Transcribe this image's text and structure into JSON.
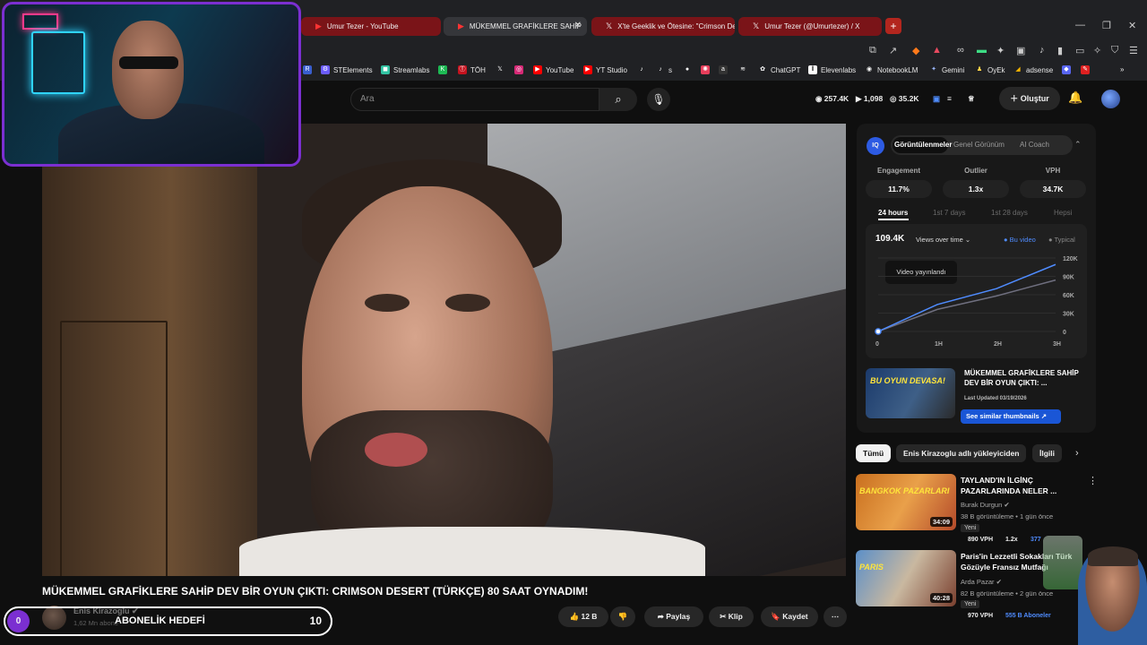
{
  "browser": {
    "tabs": [
      {
        "title": "Umur Tezer - YouTube",
        "icon": "youtube-icon"
      },
      {
        "title": "MÜKEMMEL GRAFİKLERE SAHİP",
        "icon": "youtube-icon"
      },
      {
        "title": "X'te Geeklik ve Ötesine: \"Crimson De",
        "icon": "x-icon"
      },
      {
        "title": "Umur Tezer (@Umurtezer) / X",
        "icon": "x-icon"
      }
    ],
    "new_tab": "+",
    "bookmarks": [
      "STElements",
      "Streamlabs",
      "TÖH",
      "YouTube",
      "YT Studio",
      "s",
      "ChatGPT",
      "Elevenlabs",
      "NotebookLM",
      "Gemini",
      "OyEk",
      "adsense"
    ]
  },
  "header": {
    "search_placeholder": "Ara",
    "stats": {
      "views": "257.4K",
      "videos": "1,098",
      "subs": "35.2K"
    },
    "create_label": "Oluştur"
  },
  "panel": {
    "logo": "IQ",
    "tabs": [
      "Görüntülenmeler",
      "Genel Görünüm",
      "AI Coach"
    ],
    "metrics": [
      {
        "label": "Engagement",
        "value": "11.7%"
      },
      {
        "label": "Outlier",
        "value": "1.3x"
      },
      {
        "label": "VPH",
        "value": "34.7K"
      }
    ],
    "ranges": [
      "24 hours",
      "1st 7 days",
      "1st 28 days",
      "Hepsi"
    ],
    "total": "109.4K",
    "dropdown": "Views over time",
    "legend": {
      "this": "Bu video",
      "typical": "Typical"
    },
    "tooltip": "Video yayınlandı",
    "card": {
      "thumb_text": "BU OYUN DEVASA!",
      "title": "MÜKEMMEL GRAFİKLERE SAHİP DEV BİR OYUN ÇIKTI: ...",
      "updated": "Last Updated 03/19/2026",
      "button": "See similar thumbnails"
    }
  },
  "chart_data": {
    "type": "line",
    "x": [
      "0",
      "1H",
      "2H",
      "3H"
    ],
    "y_ticks": [
      "0",
      "30K",
      "60K",
      "90K",
      "120K"
    ],
    "ylim": [
      0,
      120000
    ],
    "series": [
      {
        "name": "Bu video",
        "values": [
          0,
          44000,
          70000,
          109400
        ],
        "color": "#4f8cff"
      },
      {
        "name": "Typical",
        "values": [
          0,
          36000,
          58000,
          84000
        ],
        "color": "#6f6f7f"
      }
    ]
  },
  "chips": [
    "Tümü",
    "Enis Kirazoglu adlı yükleyiciden",
    "İlgili"
  ],
  "related": [
    {
      "thumb_text": "BANGKOK PAZARLARI",
      "duration": "34:09",
      "title": "TAYLAND'IN İLGİNÇ PAZARLARINDA NELER ...",
      "channel": "Burak Durgun",
      "meta": "38 B görüntüleme • 1 gün önce",
      "badge": "Yeni",
      "vph": "890 VPH",
      "ratio": "1.2x",
      "extra": "377"
    },
    {
      "thumb_text": "PARIS",
      "duration": "40:28",
      "title": "Paris'in Lezzetli Sokakları Türk Gözüyle Fransız Mutfağı",
      "channel": "Arda Pazar",
      "meta": "82 B görüntüleme • 2 gün önce",
      "badge": "Yeni",
      "vph": "970 VPH",
      "ratio": "555 B Aboneler",
      "extra": ""
    }
  ],
  "video": {
    "title": "MÜKEMMEL GRAFİKLERE SAHİP DEV BİR OYUN ÇIKTI: CRIMSON DESERT (TÜRKÇE) 80 SAAT OYNADIM!",
    "channel": "Enis Kirazoglu",
    "subs": "1,62 Mn abone",
    "likes": "12 B",
    "share": "Paylaş",
    "clip": "Klip",
    "save": "Kaydet"
  },
  "sub_goal": {
    "current": "0",
    "label": "ABONELİK HEDEFİ",
    "goal": "10"
  },
  "colors": {
    "accent": "#7b2fd1",
    "youtube_red": "#ff0000",
    "chart_blue": "#4f8cff"
  }
}
